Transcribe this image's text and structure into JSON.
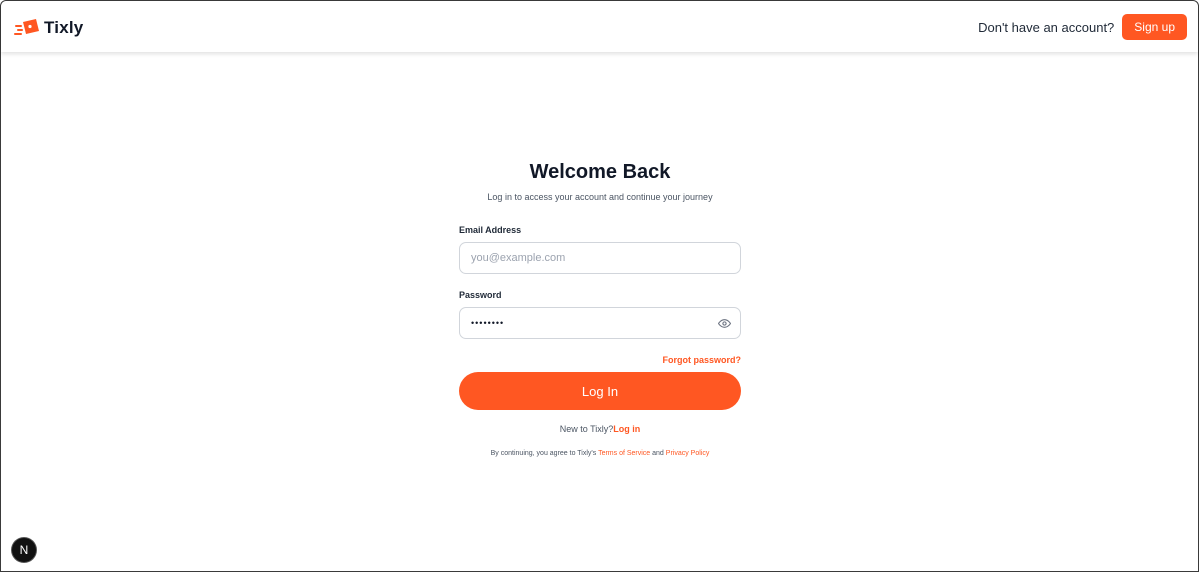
{
  "brand": {
    "name": "Tixly",
    "accent_color": "#ff5722",
    "logo_icon": "ticket-flying-icon"
  },
  "header": {
    "account_prompt": "Don't have an account?",
    "signup_label": "Sign up"
  },
  "login": {
    "title": "Welcome Back",
    "subtitle": "Log in to access your account and continue your journey",
    "email": {
      "label": "Email Address",
      "placeholder": "you@example.com",
      "value": ""
    },
    "password": {
      "label": "Password",
      "value": "••••••••",
      "toggle_icon": "eye-icon"
    },
    "forgot_label": "Forgot password?",
    "submit_label": "Log In",
    "new_prefix": "New to Tixly?",
    "new_link": "Log in",
    "terms": {
      "prefix": "By continuing, you agree to Tixly's ",
      "tos": "Terms of Service",
      "and": " and ",
      "privacy": "Privacy Policy"
    }
  },
  "dev_badge": {
    "letter": "N"
  }
}
